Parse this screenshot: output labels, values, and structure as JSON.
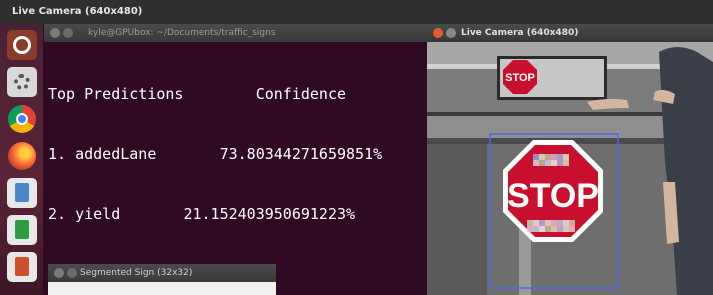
{
  "topbar": {
    "title": "Live Camera (640x480)"
  },
  "launcher": {
    "icons": [
      "ubuntu-icon",
      "settings-icon",
      "chrome-icon",
      "firefox-icon",
      "writer-icon",
      "calc-icon",
      "impress-icon"
    ]
  },
  "terminal": {
    "title": "kyle@GPUbox: ~/Documents/traffic_signs",
    "lines": [
      "Top Predictions        Confidence",
      "1. addedLane       73.80344271659851%",
      "2. yield       21.152403950691223%"
    ]
  },
  "segmented_window": {
    "title": "Segmented Sign (32x32)"
  },
  "camera_window": {
    "title": "Live Camera (640x480)",
    "sign_text": "STOP",
    "monitor_sign_text": "STOP"
  },
  "colors": {
    "terminal_bg": "#300a24",
    "stop_red": "#c8102e",
    "bbox_blue": "#4a6ee8"
  }
}
